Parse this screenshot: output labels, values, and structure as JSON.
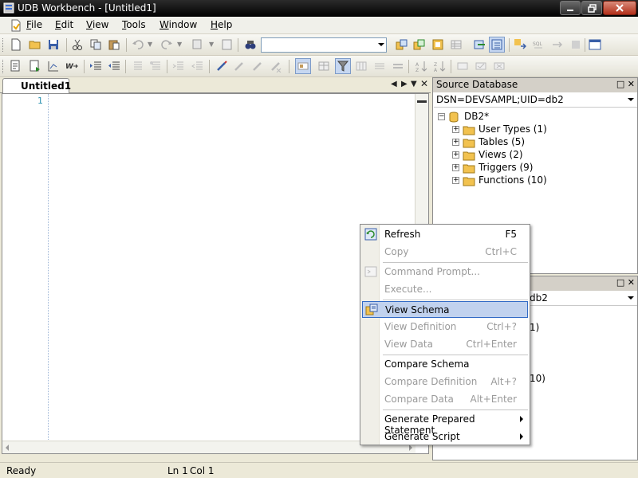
{
  "window": {
    "title": "UDB Workbench - [Untitled1]"
  },
  "menu": [
    {
      "label": "File",
      "mnemonic": "F"
    },
    {
      "label": "Edit",
      "mnemonic": "E"
    },
    {
      "label": "View",
      "mnemonic": "V"
    },
    {
      "label": "Tools",
      "mnemonic": "T"
    },
    {
      "label": "Window",
      "mnemonic": "W"
    },
    {
      "label": "Help",
      "mnemonic": "H"
    }
  ],
  "toolbar": {
    "row1_icons": [
      "new-doc-icon",
      "open-folder-icon",
      "save-icon",
      "cut-icon",
      "copy-icon",
      "paste-icon",
      "undo-icon",
      "redo-icon",
      "script-icon",
      "export-icon",
      "find-icon"
    ],
    "combo_value": "",
    "row1_right_icons": [
      "connect-icon",
      "disconnect-icon",
      "db-add-icon",
      "grid-icon",
      "refresh-icon",
      "schema-icon",
      "transfer-icon",
      "sql-icon",
      "arrow-icon",
      "stop-icon",
      "window-icon"
    ],
    "row2_icons": [
      "query-icon",
      "query-run-icon",
      "query-plan-icon",
      "word-wrap-icon",
      "indent-icon",
      "outdent-icon",
      "comment-icon",
      "uncomment-icon",
      "increase-indent-icon",
      "decrease-indent-icon",
      "bookmark-icon",
      "prev-bookmark-icon",
      "next-bookmark-icon",
      "clear-bookmark-icon",
      "filter-toggle-icon",
      "filter-icon",
      "table-icon",
      "sort-asc-icon",
      "sort-desc-icon",
      "zoom-icon",
      "check-icon",
      "cancel-icon"
    ]
  },
  "editor": {
    "tab_label": "Untitled1",
    "line_numbers": [
      "1"
    ]
  },
  "source_panel": {
    "title": "Source Database",
    "dsn": "DSN=DEVSAMPL;UID=db2",
    "tree": {
      "root": "DB2*",
      "children": [
        "User Types (1)",
        "Tables (5)",
        "Views (2)",
        "Triggers (9)",
        "Functions (10)"
      ]
    }
  },
  "lower_panel": {
    "dsn_partial": "db2",
    "visible_fragments": [
      "1)",
      "10)"
    ]
  },
  "context_menu": {
    "items": [
      {
        "label": "Refresh",
        "shortcut": "F5",
        "enabled": true,
        "icon": "refresh-icon"
      },
      {
        "label": "Copy",
        "shortcut": "Ctrl+C",
        "enabled": false
      },
      {
        "label": "Command Prompt...",
        "shortcut": "",
        "enabled": false,
        "icon": "command-prompt-icon"
      },
      {
        "label": "Execute...",
        "shortcut": "",
        "enabled": false
      },
      {
        "label": "View Schema",
        "shortcut": "",
        "enabled": true,
        "selected": true,
        "icon": "view-schema-icon"
      },
      {
        "label": "View Definition",
        "shortcut": "Ctrl+?",
        "enabled": false
      },
      {
        "label": "View Data",
        "shortcut": "Ctrl+Enter",
        "enabled": false
      },
      {
        "label": "Compare Schema",
        "shortcut": "",
        "enabled": true
      },
      {
        "label": "Compare Definition",
        "shortcut": "Alt+?",
        "enabled": false
      },
      {
        "label": "Compare Data",
        "shortcut": "Alt+Enter",
        "enabled": false
      },
      {
        "label": "Generate Prepared Statement",
        "shortcut": "",
        "enabled": true,
        "submenu": true
      },
      {
        "label": "Generate Script",
        "shortcut": "",
        "enabled": true,
        "submenu": true
      }
    ]
  },
  "status": {
    "text": "Ready",
    "line": "Ln 1",
    "col": "Col 1"
  },
  "colors": {
    "titlebar": "#000000",
    "selection": "#c1d2ee",
    "selection_border": "#316ac5",
    "folder": "#f2c24f",
    "disabled_text": "#9a9a9a"
  }
}
